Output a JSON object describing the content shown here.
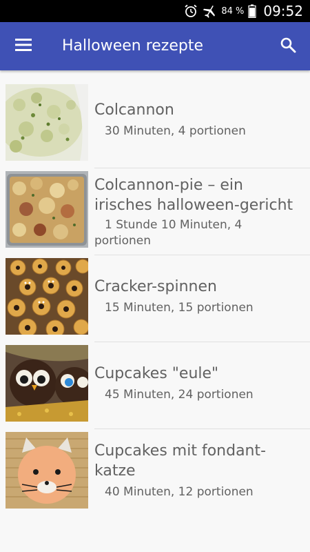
{
  "status_bar": {
    "battery_percent": "84 %",
    "clock": "09:52",
    "icons": [
      "alarm-icon",
      "airplane-icon",
      "battery-icon"
    ]
  },
  "app_bar": {
    "title": "Halloween rezepte",
    "menu_icon": "menu-icon",
    "search_icon": "search-icon",
    "color": "#3f51b5"
  },
  "recipes": [
    {
      "title": "Colcannon",
      "meta": "30 Minuten, 4 portionen"
    },
    {
      "title": "Colcannon-pie – ein irisches halloween-gericht",
      "meta": "1 Stunde 10 Minuten, 4 portionen"
    },
    {
      "title": "Cracker-spinnen",
      "meta": "15 Minuten, 15 portionen"
    },
    {
      "title": "Cupcakes \"eule\"",
      "meta": "45 Minuten, 24 portionen"
    },
    {
      "title": "Cupcakes mit fondant-katze",
      "meta": "40 Minuten, 12 portionen"
    }
  ]
}
